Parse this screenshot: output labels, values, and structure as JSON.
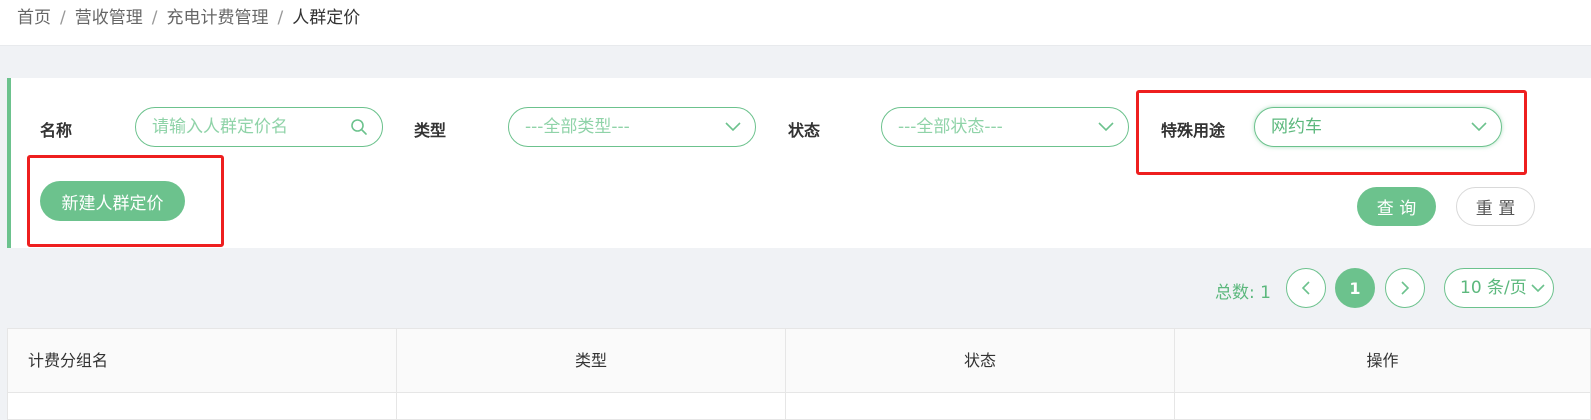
{
  "breadcrumb": {
    "items": [
      "首页",
      "营收管理",
      "充电计费管理",
      "人群定价"
    ],
    "separator": "/"
  },
  "filters": {
    "name_label": "名称",
    "name_placeholder": "请输入人群定价名",
    "type_label": "类型",
    "type_value": "---全部类型---",
    "status_label": "状态",
    "status_value": "---全部状态---",
    "special_label": "特殊用途",
    "special_value": "网约车"
  },
  "actions": {
    "new_label": "新建人群定价",
    "query_label": "查 询",
    "reset_label": "重 置"
  },
  "pagination": {
    "total_text": "总数: 1",
    "current_page": "1",
    "page_size": "10 条/页"
  },
  "table": {
    "columns": [
      "计费分组名",
      "类型",
      "状态",
      "操作"
    ]
  },
  "colors": {
    "accent": "#6cc28d",
    "highlight": "#ee1f1f"
  },
  "icons": {
    "search": "search-icon",
    "dropdown": "chevron-down-icon",
    "prev": "chevron-left-icon",
    "next": "chevron-right-icon"
  }
}
